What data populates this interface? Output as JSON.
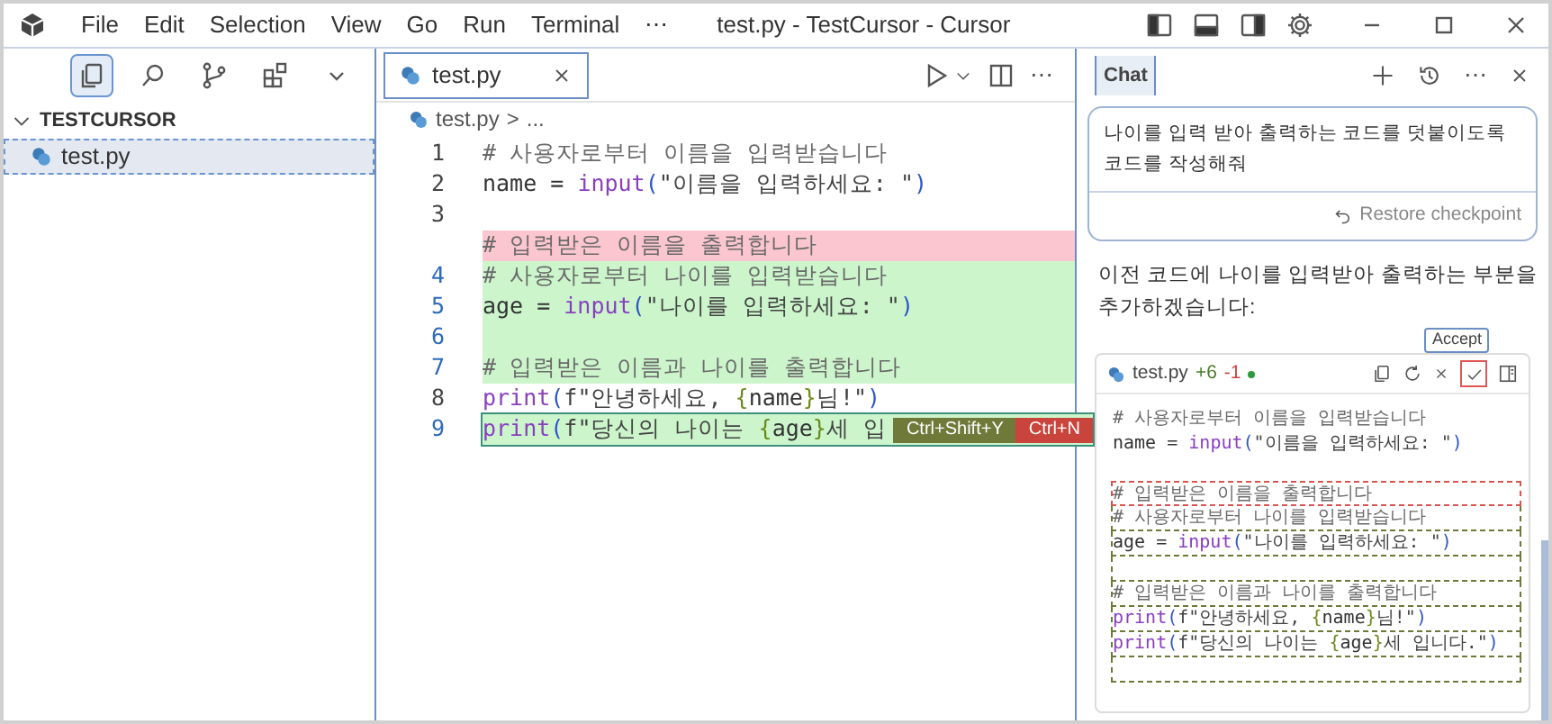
{
  "title_bar": {
    "menus": [
      "File",
      "Edit",
      "Selection",
      "View",
      "Go",
      "Run",
      "Terminal",
      "⋯"
    ],
    "title": "test.py - TestCursor - Cursor"
  },
  "activity_bar": {
    "icons": [
      {
        "kind": "files",
        "selected": true
      },
      {
        "kind": "search",
        "selected": false
      },
      {
        "kind": "source-control",
        "selected": false
      },
      {
        "kind": "extensions",
        "selected": false
      },
      {
        "kind": "chevron",
        "selected": false
      }
    ]
  },
  "explorer": {
    "header": "TESTCURSOR",
    "expanded": true,
    "files": [
      {
        "name": "test.py",
        "selected": true
      }
    ]
  },
  "editor": {
    "tab": {
      "label": "test.py",
      "selected": true
    },
    "more": "⋯",
    "breadcrumb": {
      "file": "test.py",
      "separator": ">",
      "rest": "..."
    },
    "lines": [
      {
        "number": "1",
        "kind": "normal",
        "current": false,
        "tokens": [
          {
            "t": "# 사용자로부터 이름을 입력받습니다",
            "kind": "comment"
          }
        ]
      },
      {
        "number": "2",
        "kind": "normal",
        "current": false,
        "tokens": [
          {
            "t": "name = ",
            "kind": "plain"
          },
          {
            "t": "input",
            "kind": "func"
          },
          {
            "t": "(",
            "kind": "paren"
          },
          {
            "t": "\"이름을 입력하세요: \"",
            "kind": "string"
          },
          {
            "t": ")",
            "kind": "paren"
          }
        ]
      },
      {
        "number": "3",
        "kind": "normal",
        "current": false
      },
      {
        "kind": "deleted",
        "current": false,
        "tokens": [
          {
            "t": "# 입력받은 이름을 출력합니다",
            "kind": "comment"
          }
        ]
      },
      {
        "number": "4",
        "kind": "added",
        "current": false,
        "tokens": [
          {
            "t": "# 사용자로부터 나이를 입력받습니다",
            "kind": "comment"
          }
        ]
      },
      {
        "number": "5",
        "kind": "added",
        "current": false,
        "tokens": [
          {
            "t": "age = ",
            "kind": "plain"
          },
          {
            "t": "input",
            "kind": "func"
          },
          {
            "t": "(",
            "kind": "paren"
          },
          {
            "t": "\"나이를 입력하세요: \"",
            "kind": "string"
          },
          {
            "t": ")",
            "kind": "paren"
          }
        ]
      },
      {
        "number": "6",
        "kind": "added",
        "current": false
      },
      {
        "number": "7",
        "kind": "added",
        "current": false,
        "tokens": [
          {
            "t": "# 입력받은 이름과 나이를 출력합니다",
            "kind": "comment"
          }
        ]
      },
      {
        "number": "8",
        "kind": "normal",
        "current": false,
        "tokens": [
          {
            "t": "print",
            "kind": "func"
          },
          {
            "t": "(",
            "kind": "paren"
          },
          {
            "t": "f\"안녕하세요, ",
            "kind": "string"
          },
          {
            "t": "{",
            "kind": "brace"
          },
          {
            "t": "name",
            "kind": "plain"
          },
          {
            "t": "}",
            "kind": "brace"
          },
          {
            "t": "님!\"",
            "kind": "string"
          },
          {
            "t": ")",
            "kind": "paren"
          }
        ]
      },
      {
        "number": "9",
        "kind": "added",
        "current": true,
        "tokens": [
          {
            "t": "print",
            "kind": "func"
          },
          {
            "t": "(",
            "kind": "paren"
          },
          {
            "t": "f\"당신의 나이는 ",
            "kind": "string"
          },
          {
            "t": "{",
            "kind": "brace"
          },
          {
            "t": "age",
            "kind": "plain"
          },
          {
            "t": "}",
            "kind": "brace"
          },
          {
            "t": "세 입",
            "kind": "string"
          }
        ]
      }
    ],
    "hints": [
      {
        "label": "Ctrl+Shift+Y",
        "kind": "accept"
      },
      {
        "label": "Ctrl+N",
        "kind": "reject"
      }
    ]
  },
  "chat": {
    "tab": {
      "label": "Chat",
      "selected": true
    },
    "more": "⋯",
    "user_message": "나이를 입력 받아 출력하는 코드를 덧붙이도록 코드를 작성해줘",
    "restore": "Restore checkpoint",
    "reply": "이전 코드에 나이를 입력받아 출력하는 부분을 추가하겠습니다:",
    "code_block": {
      "file": "test.py",
      "added": "+6",
      "removed": "-1",
      "tooltip": "Accept",
      "lines": [
        {
          "kind": "normal",
          "tokens": [
            {
              "t": "# 사용자로부터 이름을 입력받습니다",
              "kind": "comment"
            }
          ]
        },
        {
          "kind": "normal",
          "tokens": [
            {
              "t": "name = ",
              "kind": "plain"
            },
            {
              "t": "input",
              "kind": "func"
            },
            {
              "t": "(",
              "kind": "paren"
            },
            {
              "t": "\"이름을 입력하세요: \"",
              "kind": "string"
            },
            {
              "t": ")",
              "kind": "paren"
            }
          ]
        },
        {
          "kind": "normal"
        },
        {
          "kind": "deleted",
          "tokens": [
            {
              "t": "# 입력받은 이름을 출력합니다",
              "kind": "comment"
            }
          ]
        },
        {
          "kind": "added",
          "tokens": [
            {
              "t": "# 사용자로부터 나이를 입력받습니다",
              "kind": "comment"
            }
          ]
        },
        {
          "kind": "added",
          "tokens": [
            {
              "t": "age = ",
              "kind": "plain"
            },
            {
              "t": "input",
              "kind": "func"
            },
            {
              "t": "(",
              "kind": "paren"
            },
            {
              "t": "\"나이를 입력하세요: \"",
              "kind": "string"
            },
            {
              "t": ")",
              "kind": "paren"
            }
          ]
        },
        {
          "kind": "added"
        },
        {
          "kind": "added",
          "tokens": [
            {
              "t": "# 입력받은 이름과 나이를 출력합니다",
              "kind": "comment"
            }
          ]
        },
        {
          "kind": "added",
          "tokens": [
            {
              "t": "print",
              "kind": "func"
            },
            {
              "t": "(",
              "kind": "paren"
            },
            {
              "t": "f\"안녕하세요, ",
              "kind": "string"
            },
            {
              "t": "{",
              "kind": "brace"
            },
            {
              "t": "name",
              "kind": "plain"
            },
            {
              "t": "}",
              "kind": "brace"
            },
            {
              "t": "님!\"",
              "kind": "string"
            },
            {
              "t": ")",
              "kind": "paren"
            }
          ]
        },
        {
          "kind": "added",
          "tokens": [
            {
              "t": "print",
              "kind": "func"
            },
            {
              "t": "(",
              "kind": "paren"
            },
            {
              "t": "f\"당신의 나이는 ",
              "kind": "string"
            },
            {
              "t": "{",
              "kind": "brace"
            },
            {
              "t": "age",
              "kind": "plain"
            },
            {
              "t": "}",
              "kind": "brace"
            },
            {
              "t": "세 입니다.\"",
              "kind": "string"
            },
            {
              "t": ")",
              "kind": "paren"
            }
          ]
        },
        {
          "kind": "added"
        }
      ]
    }
  }
}
